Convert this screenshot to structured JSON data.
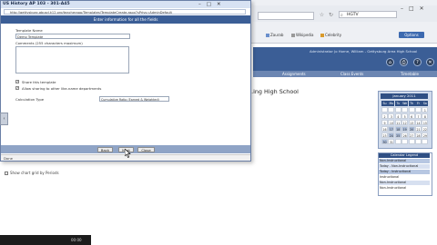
{
  "background": {
    "search_box_text": "HGTV",
    "bookmarks": [
      "Zaurab",
      "Wikipedia",
      "Celebrity"
    ],
    "options_label": "Options",
    "site_welcome": "Administrator Jo Horne, William - Gettysburg Area High School",
    "site_tabs": [
      "Assignments",
      "Class Events",
      "Timetable"
    ],
    "school_title": "...ing High School",
    "calendar": {
      "title": "January 2011",
      "dow": [
        "Su",
        "Mo",
        "Tu",
        "We",
        "Th",
        "Fr",
        "Sa"
      ],
      "days": [
        [
          "",
          "",
          "",
          "",
          "",
          "",
          "1"
        ],
        [
          "2",
          "3",
          "4",
          "5",
          "6",
          "7",
          "8"
        ],
        [
          "9",
          "10",
          "11",
          "12",
          "13",
          "14",
          "15"
        ],
        [
          "16",
          "17",
          "18",
          "19",
          "20",
          "21",
          "22"
        ],
        [
          "23",
          "24",
          "25",
          "26",
          "27",
          "28",
          "29"
        ],
        [
          "30",
          "31",
          "",
          "",
          "",
          "",
          ""
        ]
      ]
    },
    "legend": {
      "title": "Calendar Legend",
      "items": [
        "Non-Instructional",
        "Today - Non-Instructional",
        "Today - Instructional",
        "Instructional",
        "Non-Instructional",
        "Non-Instructional"
      ]
    },
    "show_checkbox_label": "Show chart grid by Periods",
    "player_time": "00:00"
  },
  "popup": {
    "title": "US History AP 103 - 301-A45",
    "url": "http://gettysburg.gbusd.k12.org/teacherapp/Templates/TemplateCreate.aspx?sPrivs=AdminDefault",
    "heading": "Enter information for all the fields",
    "name_label": "Template Name",
    "name_value": "Demo Template",
    "comment_label": "Comments (255 characters maximum)",
    "checkbox1_label": "Share this template",
    "checkbox2_label": "Allow sharing to other like-name departments",
    "calc_label": "Calculation Type",
    "calc_value": "Cumulative Ratio (Earned & Weighted)",
    "buttons": {
      "back": "Back",
      "next": "Next",
      "close": "Close"
    },
    "status": "Done"
  },
  "colors": {
    "header_blue": "#3b5e96",
    "footer_blue": "#8fa4c6",
    "titlebar": "#d7e2f3"
  },
  "icons": [
    "search-icon",
    "close-icon",
    "minimize-icon",
    "maximize-icon",
    "help-icon",
    "print-icon",
    "cursor-icon"
  ]
}
